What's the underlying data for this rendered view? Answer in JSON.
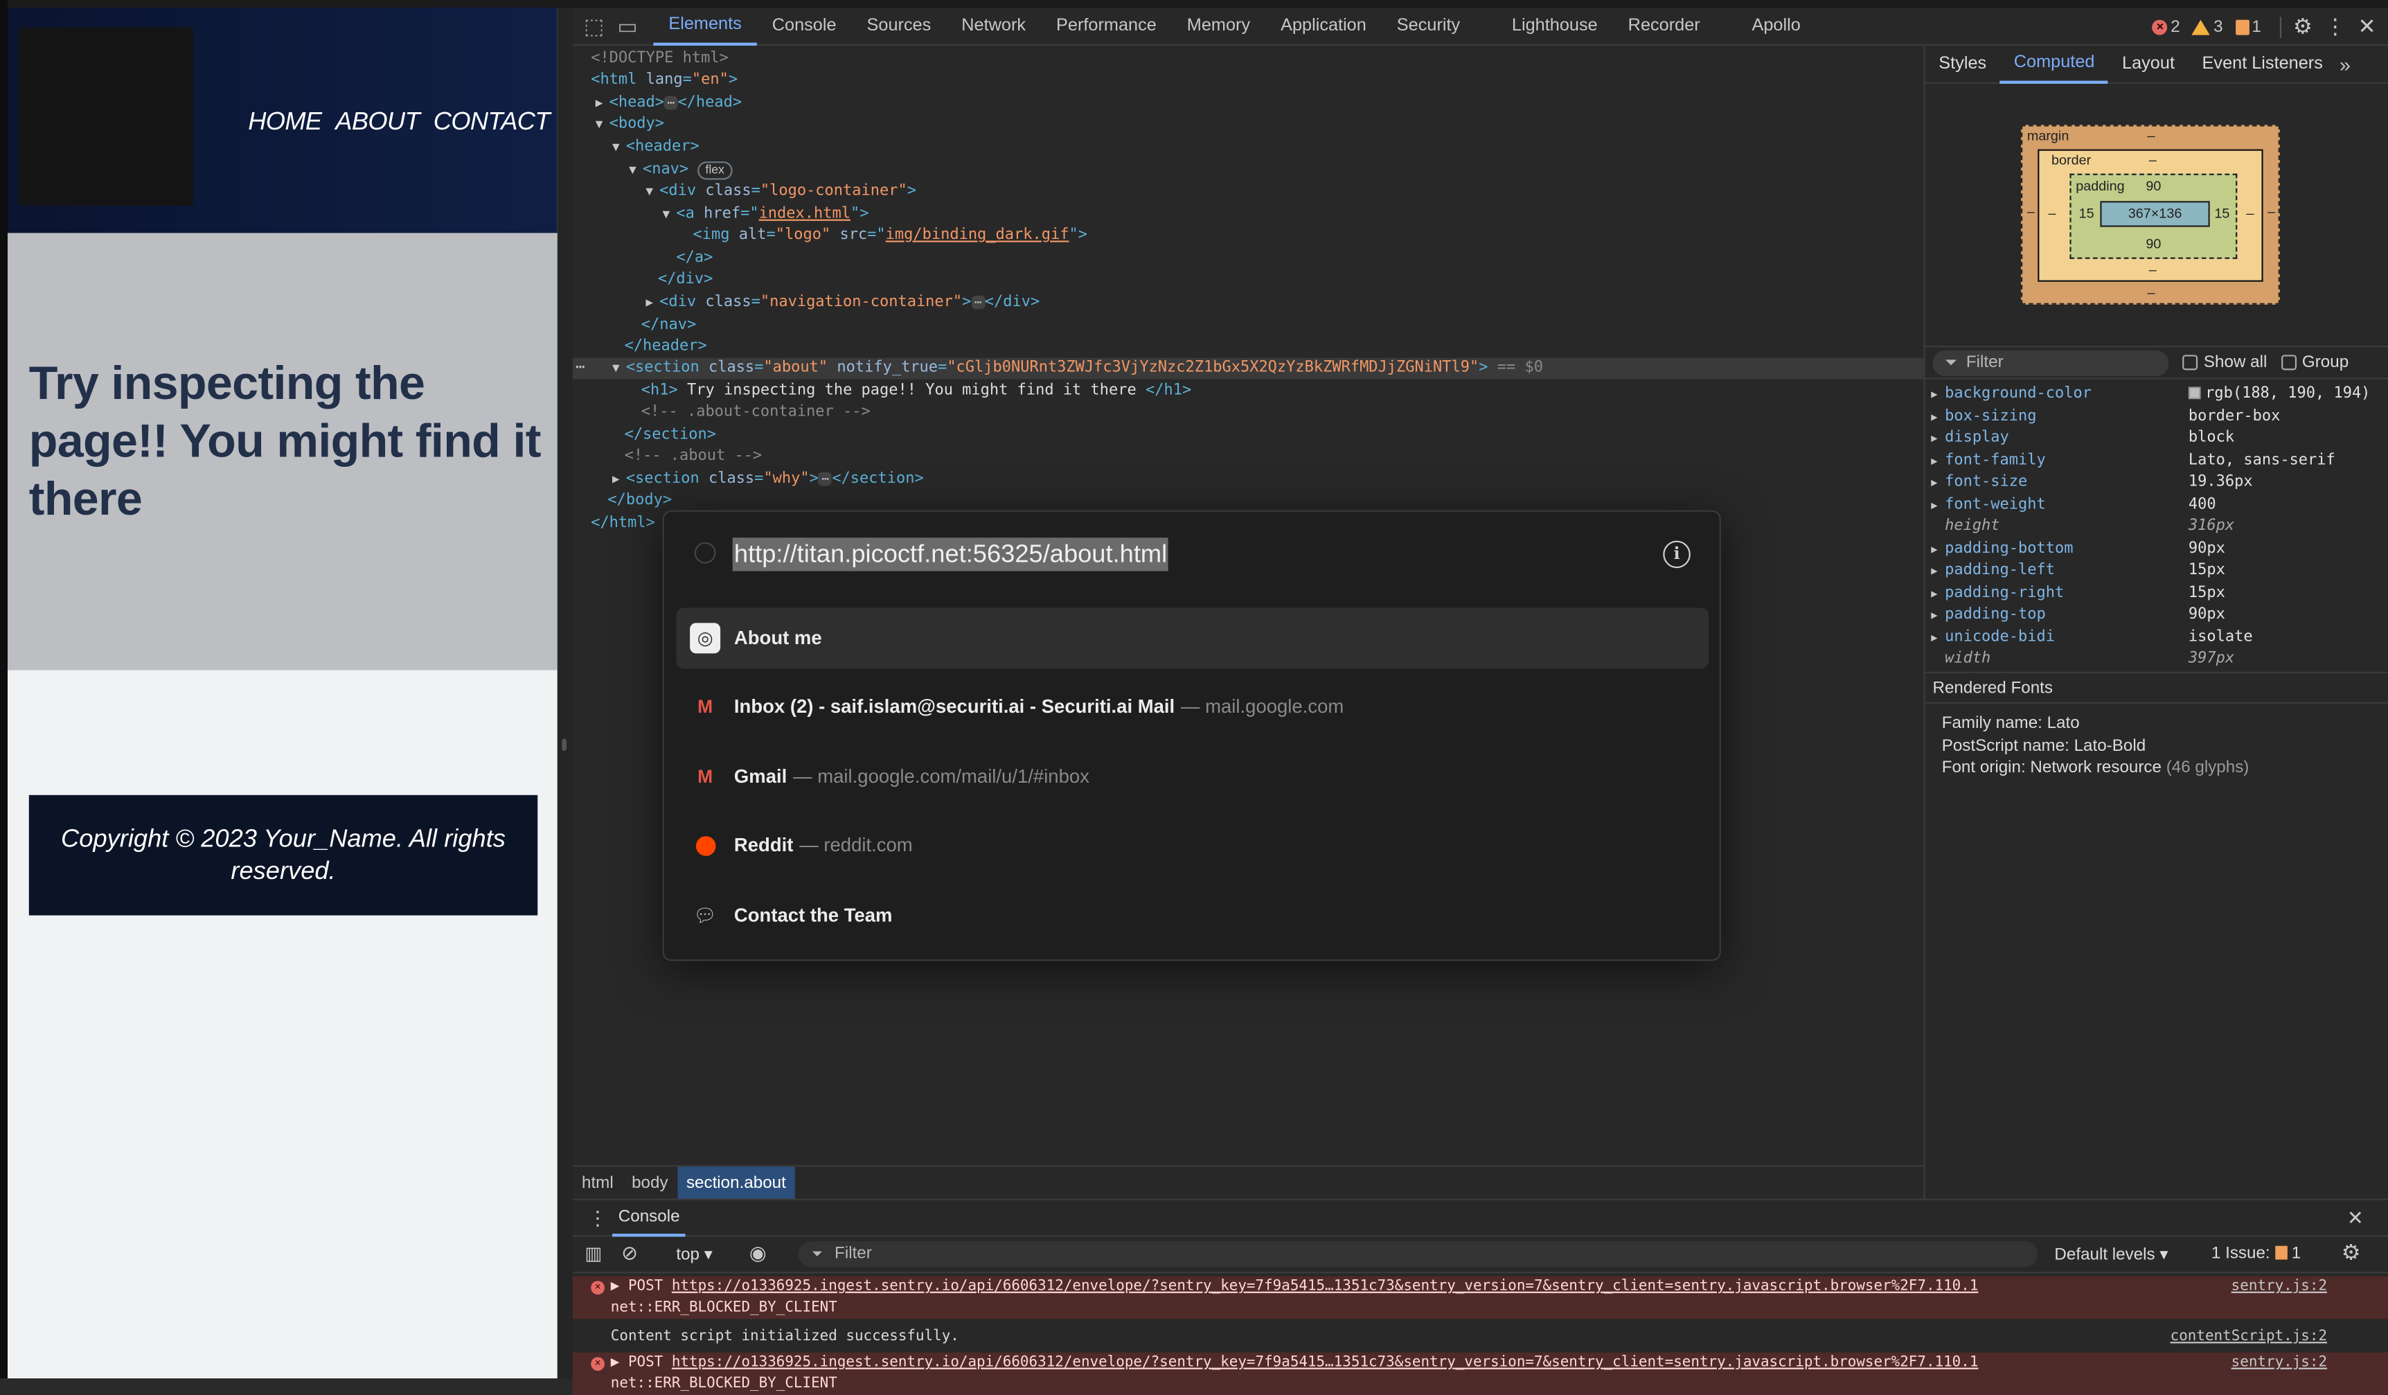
{
  "page": {
    "nav": [
      "HOME",
      "ABOUT",
      "CONTACT"
    ],
    "heading": "Try inspecting the page!! You might find it there",
    "footer": "Copyright © 2023 Your_Name. All rights reserved."
  },
  "devtools": {
    "tabs": [
      "Elements",
      "Console",
      "Sources",
      "Network",
      "Performance",
      "Memory",
      "Application",
      "Security",
      "Lighthouse",
      "Recorder",
      "Apollo"
    ],
    "active_tab": "Elements",
    "counts": {
      "errors": "2",
      "warnings": "3",
      "issues": "1"
    },
    "dom": {
      "doctype": "<!DOCTYPE html>",
      "html_open": "<html",
      "html_attr": "lang",
      "html_val": "\"en\"",
      "head": "<head>",
      "head_close": "</head>",
      "body": "<body>",
      "header": "<header>",
      "nav": "<nav>",
      "nav_pill": "flex",
      "div_logo_open": "<div",
      "class_attr": "class",
      "logo_val": "\"logo-container\"",
      "a_open": "<a",
      "href_attr": "href",
      "href_val": "index.html",
      "img_open": "<img",
      "alt_attr": "alt",
      "alt_val": "\"logo\"",
      "src_attr": "src",
      "src_val": "img/binding_dark.gif",
      "a_close": "</a>",
      "div_close": "</div>",
      "nav_container_val": "\"navigation-container\"",
      "nav_close": "</nav>",
      "header_close": "</header>",
      "section_open": "<section",
      "about_val": "\"about\"",
      "notify_attr": "notify_true",
      "notify_val": "\"cGljb0NURnt3ZWJfc3VjYzNzc2Z1bGx5X2QzYzBkZWRfMDJjZGNiNTl9\"",
      "sel_marker": "== $0",
      "h1_open": "<h1>",
      "h1_text": "Try inspecting the page!! You might find it there",
      "h1_close": "</h1>",
      "comment1": "<!-- .about-container -->",
      "section_close": "</section>",
      "comment2": "<!-- .about -->",
      "why_val": "\"why\"",
      "body_close": "</body>",
      "html_close": "</html>"
    },
    "breadcrumbs": [
      "html",
      "body",
      "section.about"
    ]
  },
  "sidebar": {
    "tabs": [
      "Styles",
      "Computed",
      "Layout",
      "Event Listeners"
    ],
    "active_tab": "Computed",
    "box_model": {
      "margin_label": "margin",
      "border_label": "border",
      "padding_label": "padding",
      "margin_dash": "–",
      "padding_top": "90",
      "padding_bottom": "90",
      "padding_left": "15",
      "padding_right": "15",
      "content": "367×136"
    },
    "filter_placeholder": "Filter",
    "show_all": "Show all",
    "group": "Group",
    "properties": [
      {
        "name": "background-color",
        "value": "rgb(188, 190, 194)"
      },
      {
        "name": "box-sizing",
        "value": "border-box"
      },
      {
        "name": "display",
        "value": "block"
      },
      {
        "name": "font-family",
        "value": "Lato, sans-serif"
      },
      {
        "name": "font-size",
        "value": "19.36px"
      },
      {
        "name": "font-weight",
        "value": "400"
      },
      {
        "name": "height",
        "value": "316px"
      },
      {
        "name": "padding-bottom",
        "value": "90px"
      },
      {
        "name": "padding-left",
        "value": "15px"
      },
      {
        "name": "padding-right",
        "value": "15px"
      },
      {
        "name": "padding-top",
        "value": "90px"
      },
      {
        "name": "unicode-bidi",
        "value": "isolate"
      },
      {
        "name": "width",
        "value": "397px"
      }
    ],
    "rendered_fonts_title": "Rendered Fonts",
    "family_name": "Family name: Lato",
    "postscript_name": "PostScript name: Lato-Bold",
    "font_origin": "Font origin: Network resource",
    "glyphs": "(46 glyphs)"
  },
  "console": {
    "tab": "Console",
    "context": "top ▾",
    "filter_placeholder": "Filter",
    "levels": "Default levels ▾",
    "issues": "1 Issue:",
    "issues_count": "1",
    "messages": [
      {
        "prefix": "▶ POST ",
        "url": "https://o1336925.ingest.sentry.io/api/6606312/envelope/?sentry_key=7f9a5415…1351c73&sentry_version=7&sentry_client=sentry.javascript.browser%2F7.110.1",
        "detail": "net::ERR_BLOCKED_BY_CLIENT",
        "source": "sentry.js:2"
      },
      {
        "text": "Content script initialized successfully.",
        "source": "contentScript.js:2"
      },
      {
        "prefix": "▶ POST ",
        "url": "https://o1336925.ingest.sentry.io/api/6606312/envelope/?sentry_key=7f9a5415…1351c73&sentry_version=7&sentry_client=sentry.javascript.browser%2F7.110.1",
        "detail": "net::ERR_BLOCKED_BY_CLIENT",
        "source": "sentry.js:2"
      }
    ]
  },
  "omnibox": {
    "url": "http://titan.picoctf.net:56325/about.html",
    "suggestions": [
      {
        "title": "About me",
        "detail": ""
      },
      {
        "title": "Inbox (2) - saif.islam@securiti.ai - Securiti.ai Mail",
        "detail": "— mail.google.com"
      },
      {
        "title": "Gmail",
        "detail": "— mail.google.com/mail/u/1/#inbox"
      },
      {
        "title": "Reddit",
        "detail": "— reddit.com"
      },
      {
        "title": "Contact the Team",
        "detail": ""
      }
    ]
  }
}
